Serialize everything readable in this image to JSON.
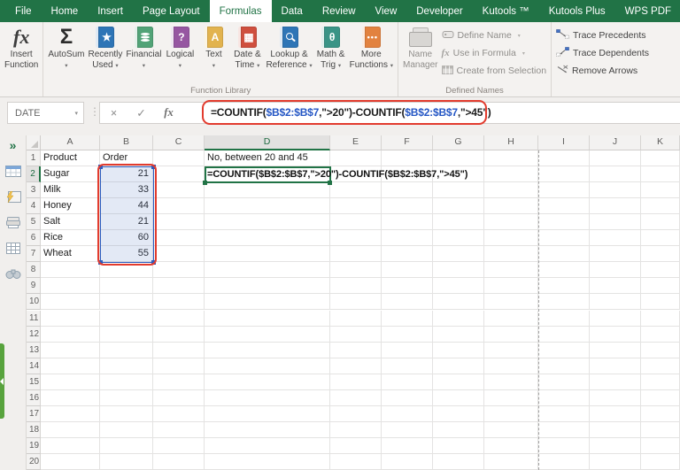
{
  "window": {
    "tabs": [
      {
        "label": "File",
        "active": false
      },
      {
        "label": "Home",
        "active": false
      },
      {
        "label": "Insert",
        "active": false
      },
      {
        "label": "Page Layout",
        "active": false
      },
      {
        "label": "Formulas",
        "active": true
      },
      {
        "label": "Data",
        "active": false
      },
      {
        "label": "Review",
        "active": false
      },
      {
        "label": "View",
        "active": false
      },
      {
        "label": "Developer",
        "active": false
      },
      {
        "label": "Kutools ™",
        "active": false
      },
      {
        "label": "Kutools Plus",
        "active": false
      },
      {
        "label": "WPS PDF",
        "active": false
      }
    ]
  },
  "ribbon": {
    "insert_function": {
      "line1": "Insert",
      "line2": "Function"
    },
    "function_library": {
      "group_label": "Function Library",
      "buttons": [
        {
          "name": "autosum",
          "line1": "AutoSum",
          "line2": "",
          "icon": "sigma-icon",
          "glyph": "Σ",
          "color": ""
        },
        {
          "name": "recently-used",
          "line1": "Recently",
          "line2": "Used",
          "icon": "book-star-icon",
          "glyph": "★",
          "color": "#2e75b6"
        },
        {
          "name": "financial",
          "line1": "Financial",
          "line2": "",
          "icon": "book-coins-icon",
          "glyph": "",
          "color": "#52a377"
        },
        {
          "name": "logical",
          "line1": "Logical",
          "line2": "",
          "icon": "book-question-icon",
          "glyph": "?",
          "color": "#9656a1"
        },
        {
          "name": "text",
          "line1": "Text",
          "line2": "",
          "icon": "book-a-icon",
          "glyph": "A",
          "color": "#e2b34e"
        },
        {
          "name": "date-time",
          "line1": "Date &",
          "line2": "Time",
          "icon": "book-calendar-icon",
          "glyph": "▦",
          "color": "#cf4f3e"
        },
        {
          "name": "lookup-reference",
          "line1": "Lookup &",
          "line2": "Reference",
          "icon": "book-magnifier-icon",
          "glyph": "",
          "color": "#2e75b6"
        },
        {
          "name": "math-trig",
          "line1": "Math &",
          "line2": "Trig",
          "icon": "book-theta-icon",
          "glyph": "θ",
          "color": "#3a9486"
        },
        {
          "name": "more-functions",
          "line1": "More",
          "line2": "Functions",
          "icon": "book-ellipsis-icon",
          "glyph": "•••",
          "color": "#e2823f"
        }
      ]
    },
    "defined_names": {
      "group_label": "Defined Names",
      "name_manager_line1": "Name",
      "name_manager_line2": "Manager",
      "items": [
        {
          "label": "Define Name",
          "icon": "define-name-icon",
          "caret": true
        },
        {
          "label": "Use in Formula",
          "icon": "use-in-formula-icon",
          "caret": true
        },
        {
          "label": "Create from Selection",
          "icon": "create-from-selection-icon",
          "caret": false
        }
      ]
    },
    "auditing": {
      "items": [
        {
          "label": "Trace Precedents",
          "icon": "trace-precedents-icon"
        },
        {
          "label": "Trace Dependents",
          "icon": "trace-dependents-icon"
        },
        {
          "label": "Remove Arrows",
          "icon": "remove-arrows-icon"
        }
      ]
    }
  },
  "formula_bar": {
    "name_box": "DATE",
    "parts": [
      {
        "text": "=COUNTIF(",
        "kind": "plain"
      },
      {
        "text": "$B$2:$B$7",
        "kind": "ref"
      },
      {
        "text": ",\">20\")-COUNTIF(",
        "kind": "plain"
      },
      {
        "text": "$B$2:$B$7",
        "kind": "ref"
      },
      {
        "text": ",\">45\")",
        "kind": "plain"
      }
    ]
  },
  "sheet": {
    "columns": [
      "A",
      "B",
      "C",
      "D",
      "E",
      "F",
      "G",
      "H",
      "I",
      "J",
      "K"
    ],
    "selected_column": "D",
    "selected_row": 2,
    "row_count": 20,
    "cells": {
      "A1": "Product",
      "B1": "Order",
      "A2": "Sugar",
      "B2": "21",
      "A3": "Milk",
      "B3": "33",
      "A4": "Honey",
      "B4": "44",
      "A5": "Salt",
      "B5": "21",
      "A6": "Rice",
      "B6": "60",
      "A7": "Wheat",
      "B7": "55",
      "D1": "No, between 20 and 45",
      "D2": "=COUNTIF($B$2:$B$7,\">20\")-COUNTIF($B$2:$B$7,\">45\")"
    }
  },
  "sidebar": {
    "icons": [
      "expand-icon",
      "table-icon",
      "formula-pane-icon",
      "printer-icon",
      "grid-icon",
      "binoculars-icon"
    ]
  },
  "colors": {
    "excel_green": "#217346",
    "annotation_red": "#e23b2e",
    "range_blue": "#2d5cbe",
    "ref_text_blue": "#2456c4"
  }
}
